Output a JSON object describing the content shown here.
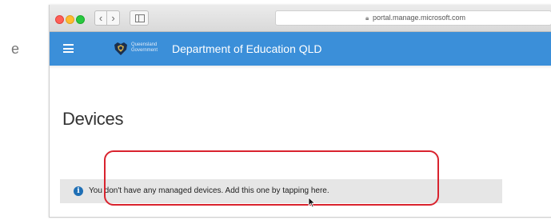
{
  "stray_text": "e",
  "browser": {
    "url": "portal.manage.microsoft.com",
    "back_icon": "chevron-left-icon",
    "forward_icon": "chevron-right-icon",
    "sidebar_icon": "sidebar-icon",
    "lock_icon": "lock-icon"
  },
  "app_header": {
    "menu_icon": "hamburger-menu-icon",
    "logo_line1": "Queensland",
    "logo_line2": "Government",
    "title": "Department of Education QLD",
    "background_color": "#3b8fd9"
  },
  "main": {
    "page_title": "Devices",
    "notice": {
      "icon": "info-icon",
      "text": "You don't have any managed devices. Add this one by tapping here."
    },
    "highlight_color": "#d9232e"
  }
}
